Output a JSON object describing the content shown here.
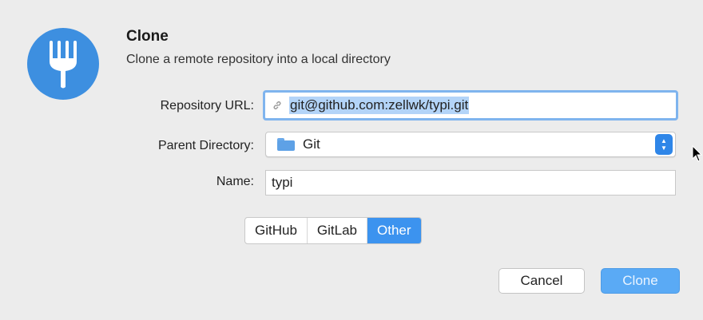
{
  "dialog": {
    "title": "Clone",
    "subtitle": "Clone a remote repository into a local directory"
  },
  "form": {
    "repository_url": {
      "label": "Repository URL:",
      "value": "git@github.com:zellwk/typi.git"
    },
    "parent_directory": {
      "label": "Parent Directory:",
      "value": "Git"
    },
    "name": {
      "label": "Name:",
      "value": "typi"
    }
  },
  "providers": {
    "tabs": [
      "GitHub",
      "GitLab",
      "Other"
    ],
    "selected": "Other"
  },
  "buttons": {
    "cancel": "Cancel",
    "clone": "Clone"
  },
  "icons": {
    "app": "fork-icon",
    "url": "link-icon",
    "directory": "folder-icon",
    "select": "up-down-stepper-icon",
    "pointer": "mouse-pointer-icon"
  },
  "colors": {
    "accent": "#3c93ef",
    "app_icon": "#3d8fe0",
    "focus_ring": "#7fb4ee",
    "selection": "#b3d4f8"
  }
}
